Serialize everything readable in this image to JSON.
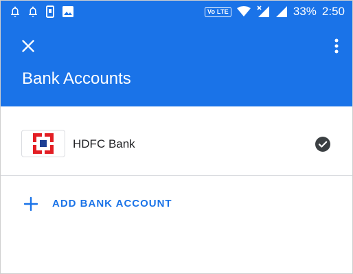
{
  "status_bar": {
    "volte_label": "Vo LTE",
    "battery_percent": "33%",
    "time": "2:50"
  },
  "app_bar": {
    "title": "Bank Accounts"
  },
  "accounts": [
    {
      "name": "HDFC Bank",
      "selected": true,
      "logo": "hdfc-logo"
    }
  ],
  "actions": {
    "add_bank_account": "ADD BANK ACCOUNT"
  },
  "colors": {
    "primary": "#1a73e8",
    "hdfc_red": "#e31e24",
    "hdfc_blue": "#1c3f94"
  }
}
